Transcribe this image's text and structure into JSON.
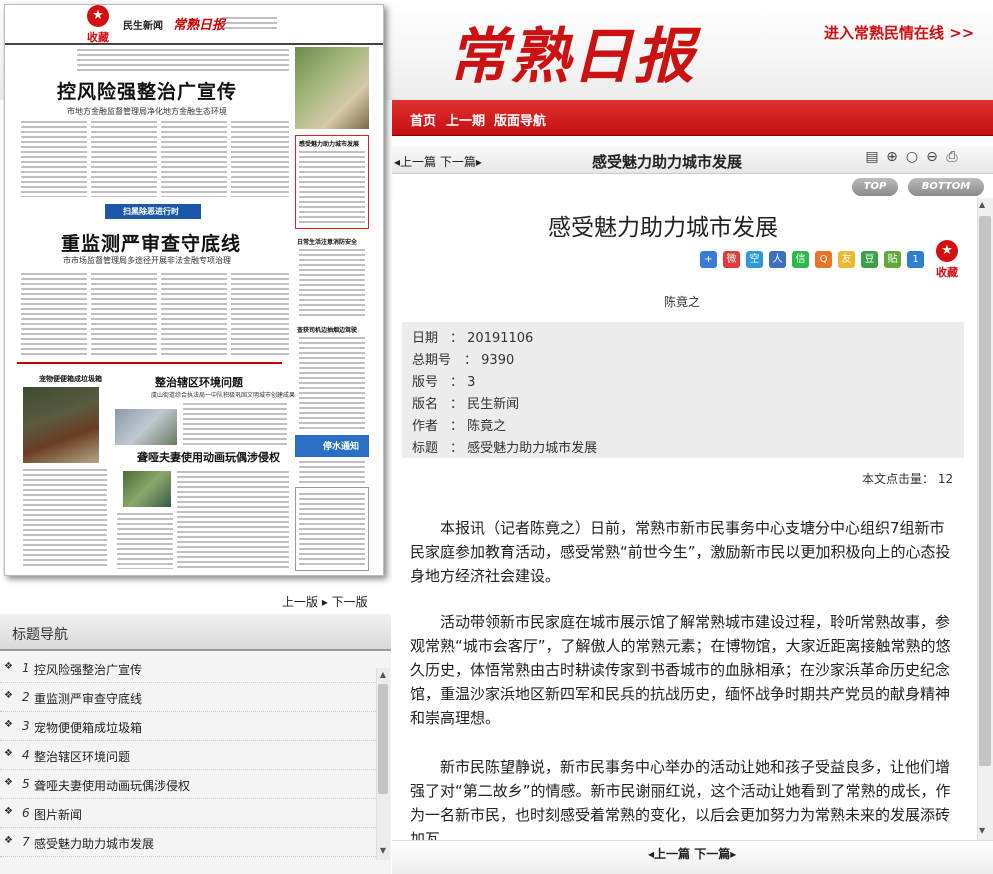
{
  "header": {
    "logo": "常熟日报",
    "minqing_link": "进入常熟民情在线 >>"
  },
  "nav": {
    "home": "首页",
    "prev_issue": "上一期",
    "page_nav": "版面导航"
  },
  "paper": {
    "collect": "收藏",
    "section_name": "民生新闻",
    "brand": "常熟日报",
    "headline1": "控风险强整治广宣传",
    "sub1": "市地方金融监督管理局净化地方金融生态环境",
    "banner": "扫黑除恶进行时",
    "headline2": "重监测严审查守底线",
    "sub2": "市市场监督管理局多途径开展非法金融专项治理",
    "boxed_title": "感受魅力助力城市发展",
    "col_title1": "日常生活注意消防安全",
    "col_title2": "查获司机边抽烟边驾驶",
    "pet_title": "宠物便便箱成垃圾箱",
    "zhengzhi": "整治辖区环境问题",
    "zhengzhi_sub": "虞山街道综合执法局一中队积极巩固文明城市创建成果",
    "yaya": "聋哑夫妻使用动画玩偶涉侵权",
    "stop_notice": "停水通知"
  },
  "page_nav_left": "上一版 ▸ 下一版",
  "title_nav": {
    "heading": "标题导航",
    "items": [
      {
        "num": "1",
        "text": "控风险强整治广宣传"
      },
      {
        "num": "2",
        "text": "重监测严审查守底线"
      },
      {
        "num": "3",
        "text": "宠物便便箱成垃圾箱"
      },
      {
        "num": "4",
        "text": "整治辖区环境问题"
      },
      {
        "num": "5",
        "text": "聋哑夫妻使用动画玩偶涉侵权"
      },
      {
        "num": "6",
        "text": "图片新闻"
      },
      {
        "num": "7",
        "text": "感受魅力助力城市发展"
      }
    ]
  },
  "article": {
    "toolbar_nav": "◂上一篇 下一篇▸",
    "toolbar_title": "感受魅力助力城市发展",
    "btn_top": "TOP",
    "btn_bottom": "BOTTOM",
    "title": "感受魅力助力城市发展",
    "collect": "收藏",
    "author": "陈竟之",
    "meta": {
      "date_label": "日期",
      "date": "20191106",
      "total_label": "总期号",
      "total": "9390",
      "page_label": "版号",
      "page": "3",
      "section_label": "版名",
      "section": "民生新闻",
      "author_label": "作者",
      "author": "陈竟之",
      "title_label": "标题",
      "title": "感受魅力助力城市发展"
    },
    "hits": "本文点击量： 12",
    "paragraphs": [
      "本报讯（记者陈竟之）日前，常熟市新市民事务中心支塘分中心组织7组新市民家庭参加教育活动，感受常熟“前世今生”，激励新市民以更加积极向上的心态投身地方经济社会建设。",
      "活动带领新市民家庭在城市展示馆了解常熟城市建设过程，聆听常熟故事，参观常熟“城市会客厅”，了解傲人的常熟元素；在博物馆，大家近距离接触常熟的悠久历史，体悟常熟由古时耕读传家到书香城市的血脉相承；在沙家浜革命历史纪念馆，重温沙家浜地区新四军和民兵的抗战历史，缅怀战争时期共产党员的献身精神和崇高理想。",
      "新市民陈望静说，新市民事务中心举办的活动让她和孩子受益良多，让他们增强了对“第二故乡”的情感。新市民谢丽红说，这个活动让她看到了常熟的成长，作为一名新市民，也时刻感受着常熟的变化，以后会更加努力为常熟未来的发展添砖加瓦。"
    ],
    "bottom_nav": "◂上一篇 下一篇▸"
  },
  "colors": {
    "brand_red": "#cc1111",
    "nav_red": "#d42020",
    "meta_bg": "#ececec"
  }
}
